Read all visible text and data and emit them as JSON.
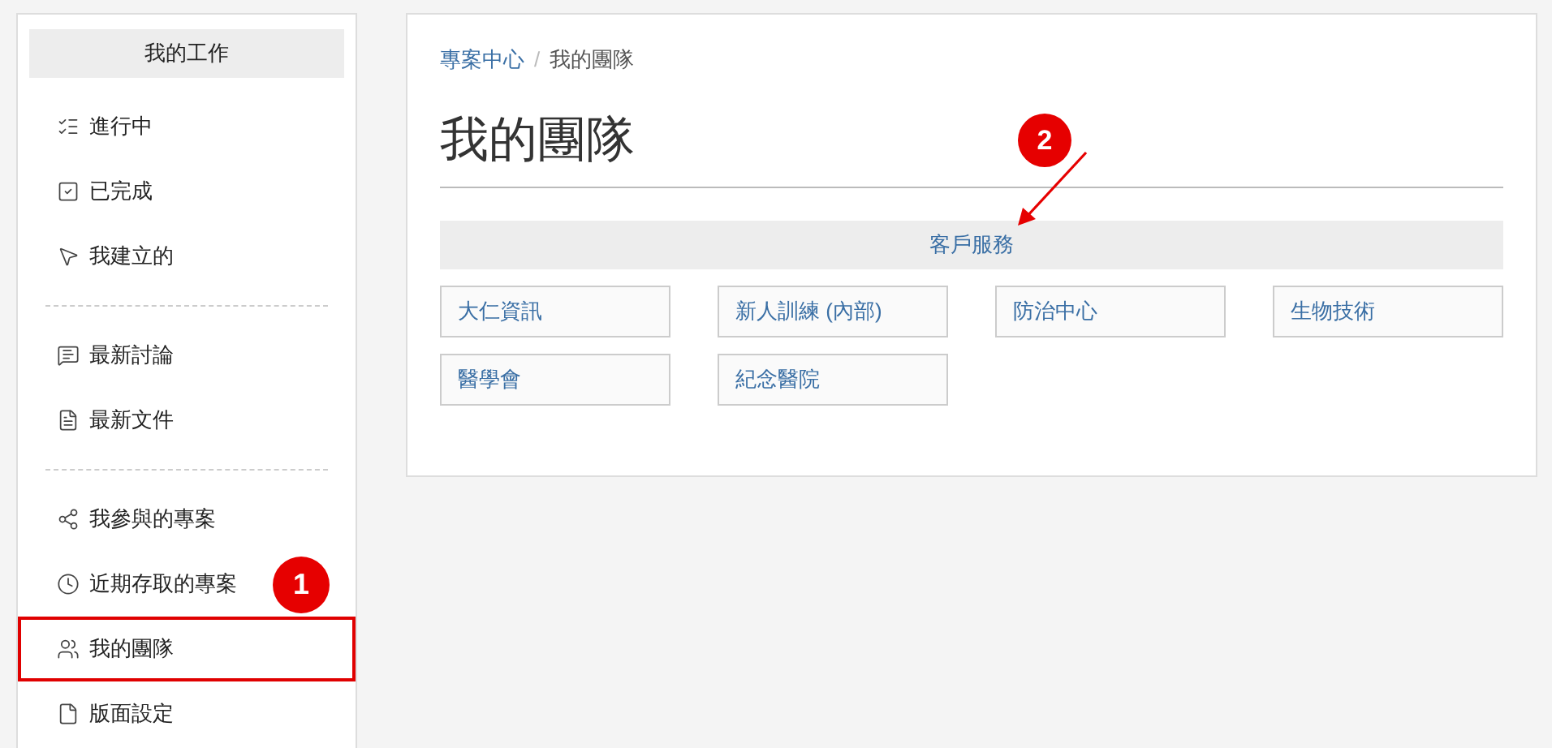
{
  "sidebar": {
    "title": "我的工作",
    "groups": [
      {
        "items": [
          {
            "label": "進行中",
            "highlighted": false
          },
          {
            "label": "已完成",
            "highlighted": false
          },
          {
            "label": "我建立的",
            "highlighted": false
          }
        ]
      },
      {
        "items": [
          {
            "label": "最新討論",
            "highlighted": false
          },
          {
            "label": "最新文件",
            "highlighted": false
          }
        ]
      },
      {
        "items": [
          {
            "label": "我參與的專案",
            "highlighted": false
          },
          {
            "label": "近期存取的專案",
            "highlighted": false
          },
          {
            "label": "我的團隊",
            "highlighted": true
          },
          {
            "label": "版面設定",
            "highlighted": false
          }
        ]
      }
    ]
  },
  "breadcrumb": [
    {
      "label": "專案中心",
      "kind": "link"
    },
    {
      "label": "/",
      "kind": "separator"
    },
    {
      "label": "我的團隊",
      "kind": "current"
    }
  ],
  "page_title": "我的團隊",
  "category": "客戶服務",
  "teams": [
    "大仁資訊",
    "新人訓練 (內部)",
    "防治中心",
    "生物技術",
    "醫學會",
    "紀念醫院"
  ],
  "annotations": [
    {
      "label": "1"
    },
    {
      "label": "2"
    }
  ]
}
